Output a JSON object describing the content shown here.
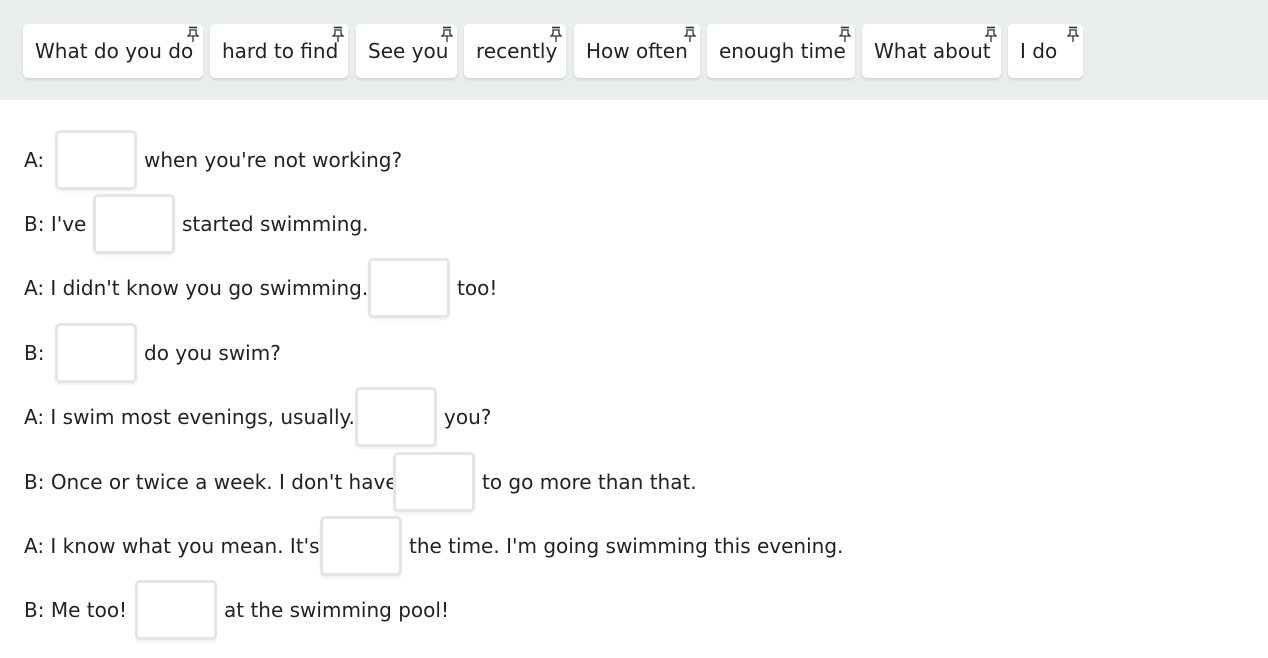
{
  "word_bank": [
    "What do you do",
    "hard to find",
    "See you",
    "recently",
    "How often",
    "enough time",
    "What about",
    "I do"
  ],
  "dialogue": [
    {
      "before": "A:",
      "after": "when you're not working?"
    },
    {
      "before": "B: I've",
      "after": "started swimming."
    },
    {
      "before": "A: I didn't know you go swimming.",
      "after": "too!"
    },
    {
      "before": "B:",
      "after": "do you swim?"
    },
    {
      "before": "A: I swim most evenings, usually.",
      "after": "you?"
    },
    {
      "before": "B: Once or twice a week. I don't have",
      "after": "to go more than that."
    },
    {
      "before": "A: I know what you mean. It's",
      "after": "the time. I'm going swimming this evening."
    },
    {
      "before": "B: Me too!",
      "after": "at the swimming pool!"
    }
  ],
  "colors": {
    "bank_background": "#e9edee",
    "drop_border": "#e4e6e6",
    "text": "#222222"
  },
  "icons": {
    "chip_marker": "pin-icon"
  }
}
